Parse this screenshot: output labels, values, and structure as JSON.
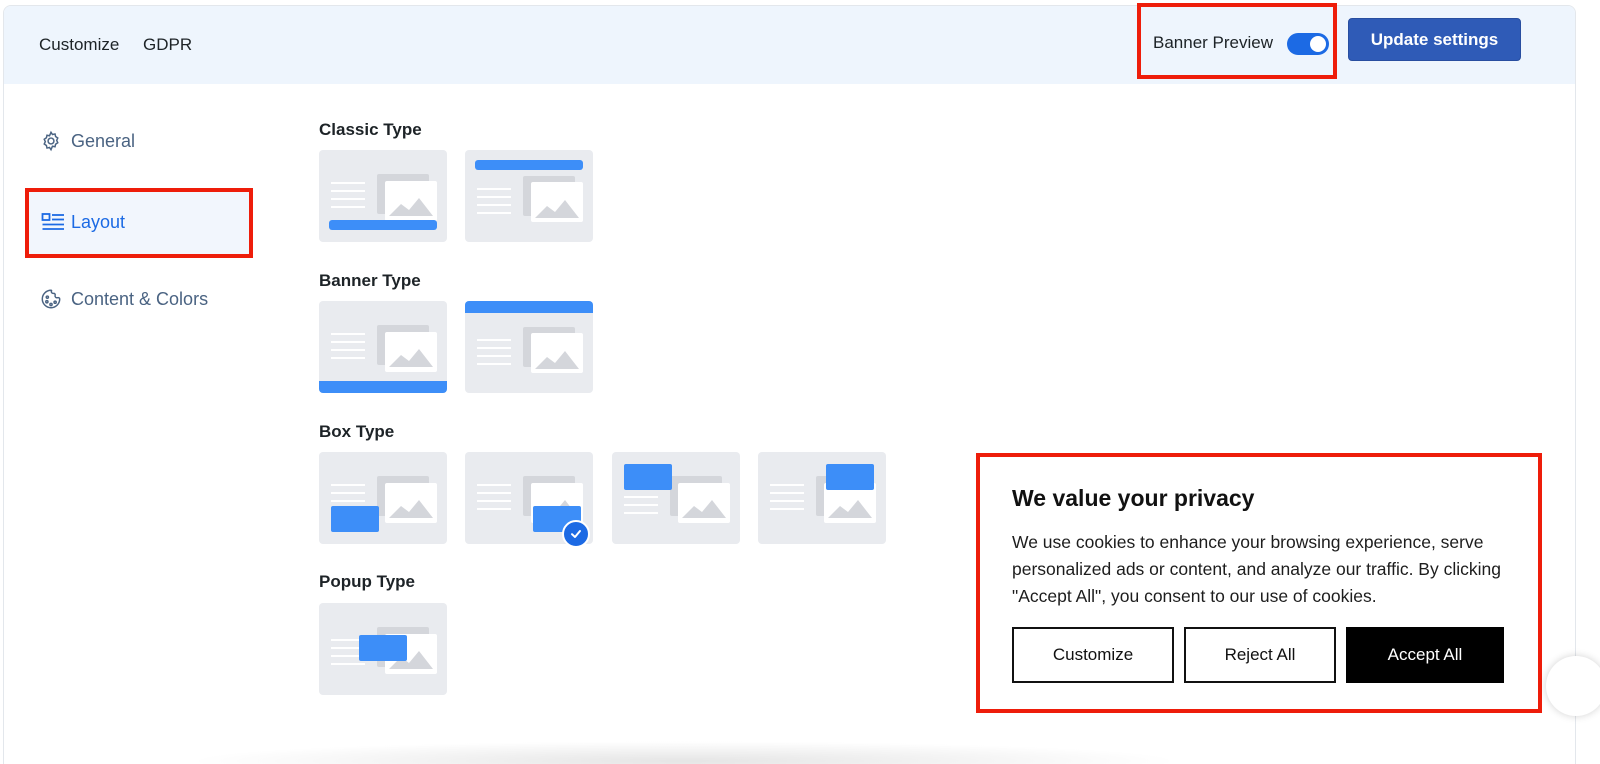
{
  "header": {
    "breadcrumb": [
      "Customize",
      "GDPR"
    ],
    "preview_label": "Banner Preview",
    "preview_enabled": true,
    "update_button": "Update settings"
  },
  "sidebar": {
    "items": [
      {
        "label": "General",
        "icon": "gear-icon"
      },
      {
        "label": "Layout",
        "icon": "layout-icon",
        "active": true
      },
      {
        "label": "Content & Colors",
        "icon": "palette-icon"
      }
    ]
  },
  "layouts": {
    "sections": [
      {
        "title": "Classic Type",
        "options": [
          "classic-bottom",
          "classic-top"
        ]
      },
      {
        "title": "Banner Type",
        "options": [
          "banner-bottom",
          "banner-top"
        ]
      },
      {
        "title": "Box Type",
        "options": [
          "box-bottom-left",
          "box-bottom-right",
          "box-top-left",
          "box-top-right"
        ],
        "selected": "box-bottom-right"
      },
      {
        "title": "Popup Type",
        "options": [
          "popup-center"
        ]
      }
    ]
  },
  "cookie_banner": {
    "title": "We value your privacy",
    "text": "We use cookies to enhance your browsing experience, serve personalized ads or content, and analyze our traffic. By clicking \"Accept All\", you consent to our use of cookies.",
    "buttons": {
      "customize": "Customize",
      "reject": "Reject All",
      "accept": "Accept All"
    }
  },
  "colors": {
    "accent": "#1c6ae4",
    "update_button": "#2f5bb7",
    "header_bg": "#eef5fd",
    "highlight": "#ee1d0a",
    "layout_blue": "#3d8ef8"
  }
}
